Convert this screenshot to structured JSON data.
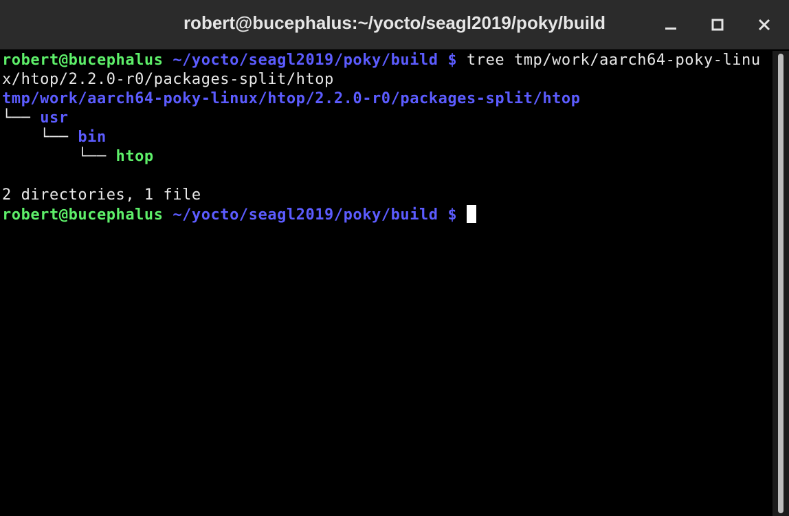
{
  "window": {
    "title": "robert@bucephalus:~/yocto/seagl2019/poky/build"
  },
  "icons": {
    "minimize": "minimize-icon",
    "maximize": "maximize-icon",
    "close": "close-icon"
  },
  "colors": {
    "titlebar": "#2b2b2b",
    "background": "#000000",
    "prompt_user": "#5ef06a",
    "prompt_path": "#5c5cff",
    "directory": "#5c5cff",
    "executable": "#5ef06a",
    "text": "#e8e8e8"
  },
  "terminal": {
    "prompt_user": "robert@bucephalus",
    "prompt_path": " ~/yocto/seagl2019/poky/build $",
    "command_part1": " tree tmp/work/aarch64-poky-linu",
    "command_part2": "x/htop/2.2.0-r0/packages-split/htop",
    "tree_root": "tmp/work/aarch64-poky-linux/htop/2.2.0-r0/packages-split/htop",
    "tree_branch_1": "└── ",
    "tree_node_1": "usr",
    "tree_branch_2": "    └── ",
    "tree_node_2": "bin",
    "tree_branch_3": "        └── ",
    "tree_node_3": "htop",
    "summary": "2 directories, 1 file",
    "prompt2_user": "robert@bucephalus",
    "prompt2_path": " ~/yocto/seagl2019/poky/build $"
  }
}
